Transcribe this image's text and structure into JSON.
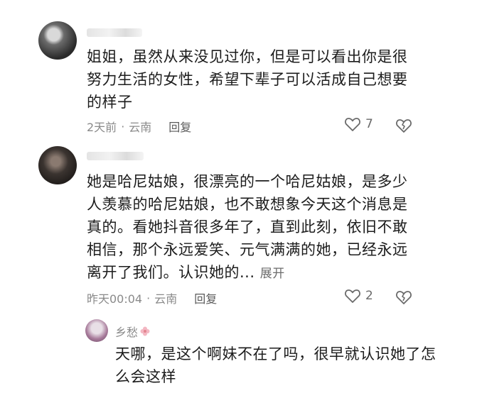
{
  "comments": [
    {
      "text": "姐姐，虽然从来没见过你，但是可以看出你是很努力生活的女性，希望下辈子可以活成自己想要的样子",
      "time": "2天前",
      "location": "云南",
      "reply_label": "回复",
      "likes": "7"
    },
    {
      "text": "她是哈尼姑娘，很漂亮的一个哈尼姑娘，是多少人羡慕的哈尼姑娘，也不敢想象今天这个消息是真的。看她抖音很多年了，直到此刻，依旧不敢相信，那个永远爱笑、元气满满的她，已经永远离开了我们。认识她的...",
      "expand_label": "展开",
      "time": "昨天00:04",
      "location": "云南",
      "reply_label": "回复",
      "likes": "2"
    }
  ],
  "reply": {
    "username": "乡愁",
    "text": "天哪，是这个啊妹不在了吗，很早就认识她了怎么会这样"
  },
  "icons": {
    "like": "heart-outline-icon",
    "dislike": "broken-heart-icon",
    "flower": "flower-icon"
  },
  "colors": {
    "text": "#1c1c1c",
    "meta": "#8a8a8a",
    "icon": "#6a6a6a"
  }
}
